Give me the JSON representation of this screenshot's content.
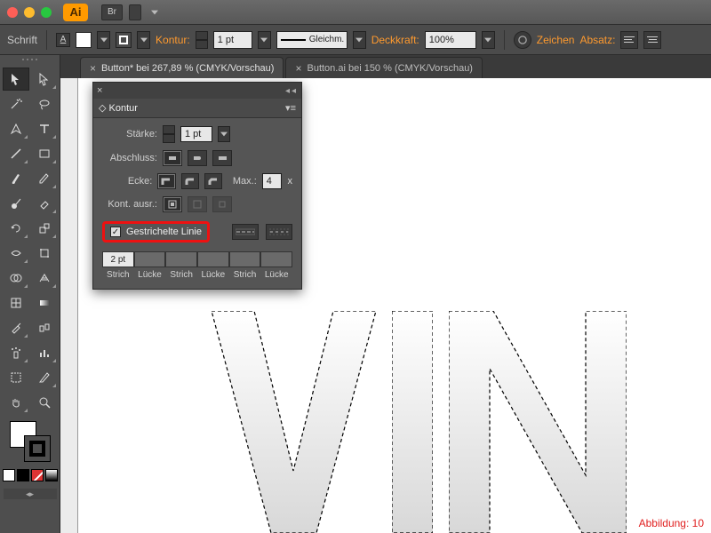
{
  "titlebar": {
    "app_badge": "Ai",
    "br_label": "Br"
  },
  "controlbar": {
    "label_left": "Schrift",
    "char_A": "A",
    "stroke_label": "Kontur:",
    "stroke_value": "1 pt",
    "line_style": "Gleichm.",
    "opacity_label": "Deckkraft:",
    "opacity_value": "100%",
    "link_zeichen": "Zeichen",
    "link_absatz": "Absatz:"
  },
  "tabs": [
    {
      "label": "Button* bei 267,89 % (CMYK/Vorschau)"
    },
    {
      "label": "Button.ai bei 150 % (CMYK/Vorschau)"
    }
  ],
  "panel": {
    "title": "Kontur",
    "rows": {
      "weight_label": "Stärke:",
      "weight_value": "1 pt",
      "cap_label": "Abschluss:",
      "corner_label": "Ecke:",
      "limit_label": "Max.:",
      "limit_value": "4",
      "limit_suffix": "x",
      "align_label": "Kont. ausr.:"
    },
    "dashed": {
      "checkbox_label": "Gestrichelte Linie",
      "value": "2 pt",
      "columns": [
        "Strich",
        "Lücke",
        "Strich",
        "Lücke",
        "Strich",
        "Lücke"
      ]
    }
  },
  "caption": "Abbildung: 10"
}
